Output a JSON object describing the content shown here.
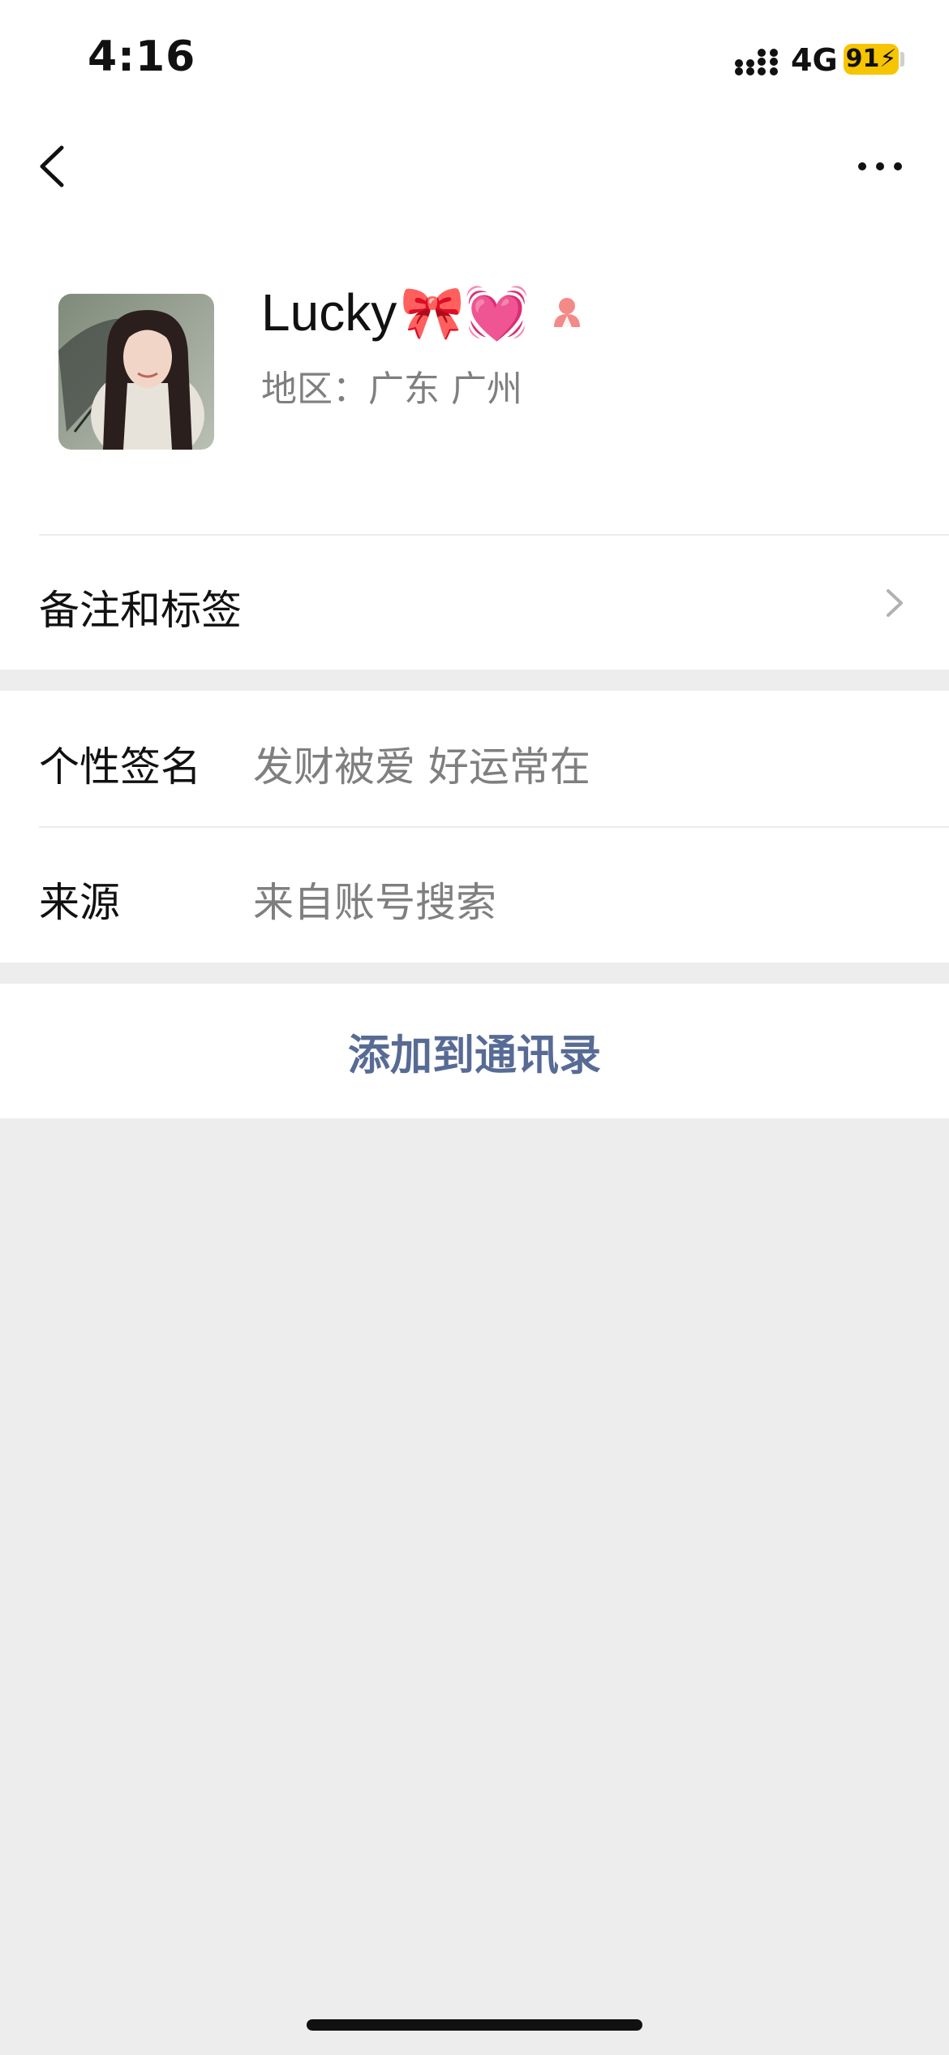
{
  "status_bar": {
    "time": "4:16",
    "network": "4G",
    "battery": "91"
  },
  "nav": {
    "back_icon": "chevron-left-icon",
    "more_icon": "ellipsis-icon"
  },
  "profile": {
    "name": "Lucky",
    "name_emoji": "🎀💓",
    "gender_icon": "female-icon",
    "region": "地区：广东 广州"
  },
  "remarks": {
    "label": "备注和标签"
  },
  "signature": {
    "label": "个性签名",
    "value": "发财被爱 好运常在"
  },
  "source": {
    "label": "来源",
    "value": "来自账号搜索"
  },
  "actions": {
    "add_contact": "添加到通讯录"
  },
  "colors": {
    "link": "#576b95",
    "background": "#ededed",
    "battery": "#f7c500",
    "gender": "#f48a88"
  }
}
